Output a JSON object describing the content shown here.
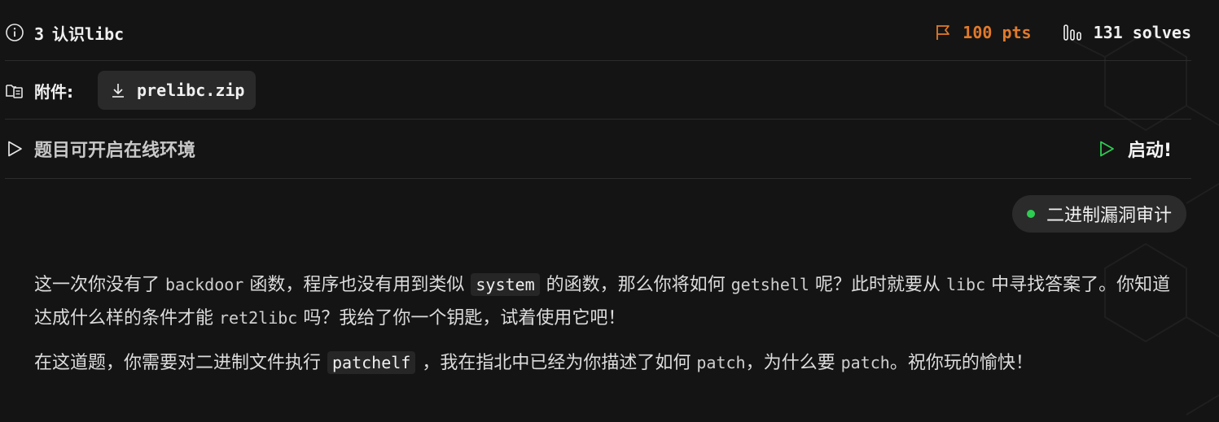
{
  "challenge": {
    "number": "3",
    "title": "认识libc",
    "points": "100 pts",
    "solves": "131 solves"
  },
  "attachment": {
    "label": "附件:",
    "file_name": "prelibc.zip"
  },
  "environment": {
    "text": "题目可开启在线环境",
    "launch_label": "启动!"
  },
  "tag": {
    "label": "二进制漏洞审计",
    "dot_color": "#2ecc52"
  },
  "description": {
    "p1": {
      "s1": "这一次你没有了",
      "c1": "backdoor",
      "s2": "函数，程序也没有用到类似",
      "code1": "system",
      "s3": "的函数，那么你将如何",
      "c2": "getshell",
      "s4": "呢？此时就要从",
      "c3": "libc",
      "s5": "中寻找答案了。你知道达成什么样的条件才能",
      "c4": "ret2libc",
      "s6": "吗？我给了你一个钥匙，试着使用它吧！"
    },
    "p2": {
      "s1": "在这道题，你需要对二进制文件执行",
      "code1": "patchelf",
      "s2": "，我在指北中已经为你描述了如何",
      "c1": "patch",
      "s3": "，为什么要",
      "c2": "patch",
      "s4": "。祝你玩的愉快！"
    }
  },
  "icons": {
    "info": "info-circle-icon",
    "flag": "flag-icon",
    "solves": "bar-chart-icon",
    "attachment": "folder-file-icon",
    "download": "download-icon",
    "play": "play-icon",
    "launch": "play-icon"
  },
  "colors": {
    "points": "#e07a2b",
    "launch_icon": "#2ecc52",
    "background": "#141414"
  }
}
